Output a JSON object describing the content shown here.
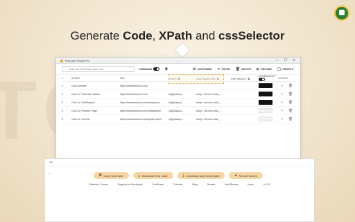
{
  "headline": {
    "prefix": "Generate ",
    "code": "Code",
    "sep1": ", ",
    "xpath": "XPath",
    "and": " and ",
    "css": "cssSelector"
  },
  "window": {
    "title": "TestCase Studio Pro",
    "search_placeholder": "Enter the Test Case name here",
    "toolbar": {
      "command": "COMMAND",
      "customize": "CUSTOMIZE",
      "filter": "FILTER",
      "delete": "DELETE",
      "record": "RECORD",
      "profile": "PROFILE"
    },
    "columns": [
      "#",
      "STEPS",
      "URL",
      "XPATH",
      "CSS SELECTOR",
      "CSP SELECT",
      "SCREENSHOT",
      "ACTION"
    ],
    "rows": [
      {
        "num": "1",
        "step": "Open website",
        "url": "https://selectorshub.com/",
        "xpath": "",
        "css": "",
        "csp": "",
        "thumb": "dark"
      },
      {
        "num": "2",
        "step": "Click on 'TestCase Studio'",
        "url": "https://selectorshub.com/",
        "xpath": "//a[@data-p...",
        "css": "body > div.elm-child_...",
        "csp": "",
        "thumb": "dark"
      },
      {
        "num": "3",
        "step": "Click on 'Certification'",
        "url": "https://selectorshub.com/testcase-st...",
        "xpath": "//a[@data-p...",
        "css": "body > div.elm-child_...",
        "csp": "",
        "thumb": "dark"
      },
      {
        "num": "4",
        "step": "Click on 'Practice Page'",
        "url": "https://selectorshub.com/certification/",
        "xpath": "//a[@data-p...",
        "css": "body > div.elm-child_...",
        "csp": "",
        "thumb": "light"
      },
      {
        "num": "5",
        "step": "Click on 'Xml list'",
        "url": "https://selectorshub.com/xpath-practi...",
        "xpath": "//a[@data-p...",
        "css": "body > div.elm-child_...",
        "csp": "",
        "thumb": "light"
      }
    ]
  },
  "panel": {
    "buttons": {
      "copy": "Copy Test Case",
      "download": "Download Test Code",
      "download_ss": "Download only Screenshot",
      "record": "Record Screen"
    },
    "footer": [
      "Selectors Course",
      "Register for Bootcamp",
      "Certificate",
      "Tutorials",
      "Blog",
      "Donate",
      "Add Review",
      "Issue",
      "v1.0.2"
    ],
    "stub": "Ne"
  },
  "colors": {
    "accent": "#f6d7a4",
    "logo": "#2e7d32",
    "highlight": "#e7b15a"
  }
}
